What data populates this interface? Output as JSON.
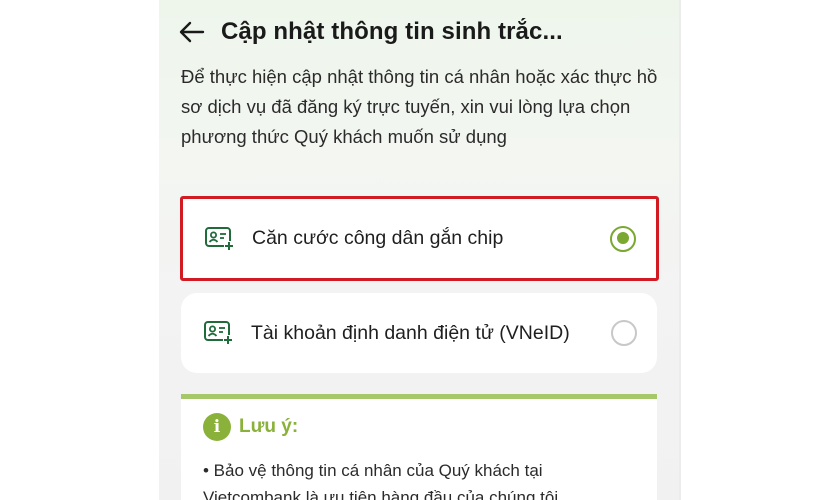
{
  "header": {
    "title": "Cập nhật thông tin sinh trắc..."
  },
  "description": "Để thực hiện cập nhật thông tin cá nhân hoặc xác thực hồ sơ dịch vụ đã đăng ký trực tuyến, xin vui lòng lựa chọn phương thức Quý khách muốn sử dụng",
  "options": [
    {
      "label": "Căn cước công dân gắn chip",
      "selected": true,
      "icon": "id-card-add-icon"
    },
    {
      "label": "Tài khoản định danh điện tử (VNeID)",
      "selected": false,
      "icon": "id-card-add-icon"
    }
  ],
  "note": {
    "icon": "info-icon",
    "icon_glyph": "i",
    "title": "Lưu ý:",
    "body": "• Bảo vệ thông tin cá nhân của Quý khách tại Vietcombank là ưu tiên hàng đầu của chúng tôi."
  },
  "colors": {
    "accent": "#7aa830",
    "highlight_border": "#d11a22",
    "icon_green": "#1f6b3a"
  }
}
